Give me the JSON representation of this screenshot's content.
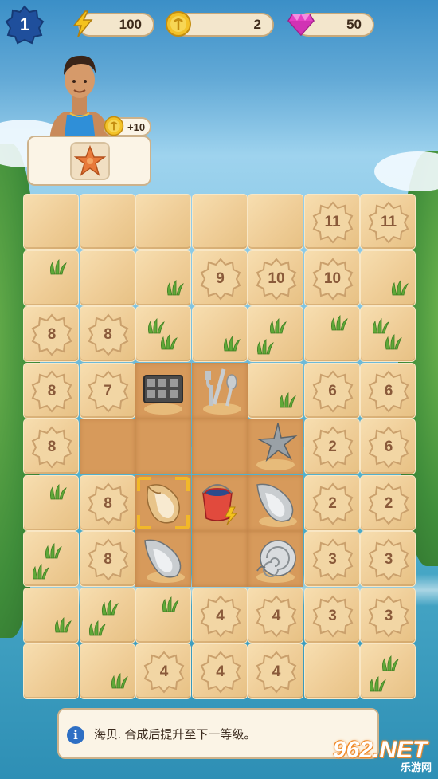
{
  "hud": {
    "level": "1",
    "energy": "100",
    "coins": "2",
    "gems": "50"
  },
  "order": {
    "reward": "+10",
    "requested_item": "starfish"
  },
  "board": {
    "rows": [
      [
        "sand",
        "sand",
        "sand",
        "sand",
        "sand",
        "lock:11",
        "lock:11"
      ],
      [
        "sand+grass",
        "sand",
        "sand+grass",
        "lock:9",
        "lock:10",
        "lock:10",
        "sand+grass"
      ],
      [
        "lock:8",
        "lock:8",
        "sand+grass",
        "sand+grass",
        "sand+grass",
        "sand+grass",
        "sand+grass"
      ],
      [
        "lock:8",
        "lock:7",
        "item:camera-box",
        "item:cutlery",
        "sand+grass",
        "lock:6",
        "lock:6"
      ],
      [
        "lock:8",
        "open",
        "open",
        "open",
        "item:starfish",
        "lock:2",
        "lock:6"
      ],
      [
        "sand+grass",
        "lock:8",
        "item:conch-shell",
        "item:bucket",
        "item:silver-conch",
        "lock:2",
        "lock:2"
      ],
      [
        "sand+grass",
        "lock:8",
        "item:silver-conch",
        "open",
        "item:snail-shell",
        "lock:3",
        "lock:3"
      ],
      [
        "sand+grass",
        "sand+grass",
        "sand+grass",
        "lock:4",
        "lock:4",
        "lock:3",
        "lock:3"
      ],
      [
        "sand",
        "sand+grass",
        "lock:4",
        "lock:4",
        "lock:4",
        "sand",
        "sand+grass"
      ]
    ],
    "selected_item": "conch-shell"
  },
  "info": {
    "text": "海贝. 合成后提升至下一等级。"
  },
  "watermark": {
    "brand": "962.NET",
    "sub": "乐游网"
  },
  "colors": {
    "resource_bar": "#f3e6cc",
    "lock_text": "#8a5a3a",
    "selection": "#f2b829",
    "info_icon": "#2e6fc4"
  }
}
